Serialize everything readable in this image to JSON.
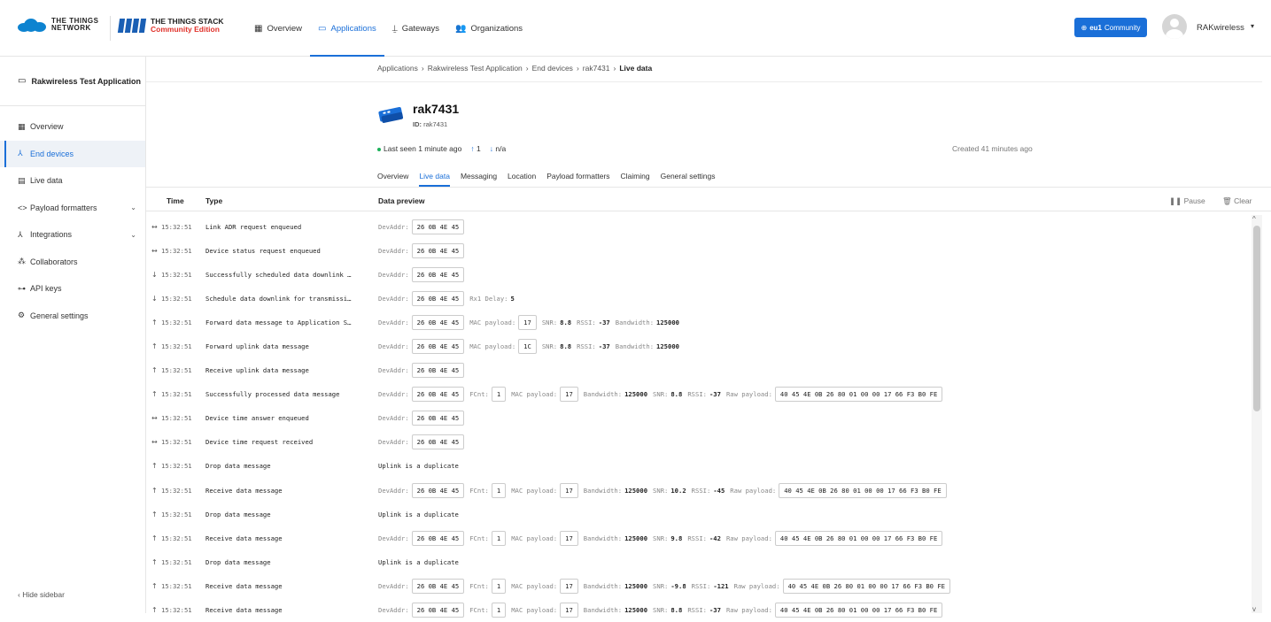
{
  "header": {
    "ttn_logo_line1": "THE THINGS",
    "ttn_logo_line2": "NETWORK",
    "stack_logo_line1": "THE THINGS STACK",
    "stack_logo_line2": "Community Edition",
    "nav": [
      {
        "label": "Overview",
        "icon": "grid-icon"
      },
      {
        "label": "Applications",
        "icon": "window-icon"
      },
      {
        "label": "Gateways",
        "icon": "gateway-icon"
      },
      {
        "label": "Organizations",
        "icon": "people-icon"
      }
    ],
    "region_bold": "eu1",
    "region_text": "Community",
    "user_name": "RAKwireless",
    "accent": "#1a6fd8"
  },
  "sidebar": {
    "app_name": "Rakwireless Test Application",
    "items": [
      {
        "label": "Overview",
        "icon": "grid-icon"
      },
      {
        "label": "End devices",
        "icon": "devices-icon"
      },
      {
        "label": "Live data",
        "icon": "live-data-icon"
      },
      {
        "label": "Payload formatters",
        "icon": "code-icon"
      },
      {
        "label": "Integrations",
        "icon": "integrations-icon"
      },
      {
        "label": "Collaborators",
        "icon": "people-icon"
      },
      {
        "label": "API keys",
        "icon": "key-icon"
      },
      {
        "label": "General settings",
        "icon": "gear-icon"
      }
    ],
    "hide_label": "Hide sidebar"
  },
  "breadcrumb": [
    "Applications",
    "Rakwireless Test Application",
    "End devices",
    "rak7431",
    "Live data"
  ],
  "device": {
    "name": "rak7431",
    "id_label": "ID:",
    "id": "rak7431",
    "last_seen": "Last seen 1 minute ago",
    "uplink": "1",
    "downlink": "n/a",
    "created": "Created 41 minutes ago"
  },
  "tabs": [
    "Overview",
    "Live data",
    "Messaging",
    "Location",
    "Payload formatters",
    "Claiming",
    "General settings"
  ],
  "table": {
    "headers": {
      "time": "Time",
      "type": "Type",
      "preview": "Data preview"
    },
    "pause_label": "Pause",
    "clear_label": "Clear",
    "rows": [
      {
        "dir": "↔",
        "time": "15:32:51",
        "type": "Link ADR request enqueued",
        "preview": [
          {
            "l": "DevAddr:",
            "b": "26 0B 4E 45"
          }
        ]
      },
      {
        "dir": "↔",
        "time": "15:32:51",
        "type": "Device status request enqueued",
        "preview": [
          {
            "l": "DevAddr:",
            "b": "26 0B 4E 45"
          }
        ]
      },
      {
        "dir": "↓",
        "time": "15:32:51",
        "type": "Successfully scheduled data downlink …",
        "preview": [
          {
            "l": "DevAddr:",
            "b": "26 0B 4E 45"
          }
        ]
      },
      {
        "dir": "↓",
        "time": "15:32:51",
        "type": "Schedule data downlink for transmissi…",
        "preview": [
          {
            "l": "DevAddr:",
            "b": "26 0B 4E 45"
          },
          {
            "l": "Rx1 Delay:",
            "v": "5"
          }
        ]
      },
      {
        "dir": "↑",
        "time": "15:32:51",
        "type": "Forward data message to Application S…",
        "preview": [
          {
            "l": "DevAddr:",
            "b": "26 0B 4E 45"
          },
          {
            "l": "MAC payload:",
            "b": "17"
          },
          {
            "l": "SNR:",
            "v": "8.8"
          },
          {
            "l": "RSSI:",
            "v": "-37"
          },
          {
            "l": "Bandwidth:",
            "v": "125000"
          }
        ]
      },
      {
        "dir": "↑",
        "time": "15:32:51",
        "type": "Forward uplink data message",
        "preview": [
          {
            "l": "DevAddr:",
            "b": "26 0B 4E 45"
          },
          {
            "l": "MAC payload:",
            "b": "1C"
          },
          {
            "l": "SNR:",
            "v": "8.8"
          },
          {
            "l": "RSSI:",
            "v": "-37"
          },
          {
            "l": "Bandwidth:",
            "v": "125000"
          }
        ]
      },
      {
        "dir": "↑",
        "time": "15:32:51",
        "type": "Receive uplink data message",
        "preview": [
          {
            "l": "DevAddr:",
            "b": "26 0B 4E 45"
          }
        ]
      },
      {
        "dir": "↑",
        "time": "15:32:51",
        "type": "Successfully processed data message",
        "preview": [
          {
            "l": "DevAddr:",
            "b": "26 0B 4E 45"
          },
          {
            "l": "FCnt:",
            "b": "1"
          },
          {
            "l": "MAC payload:",
            "b": "17"
          },
          {
            "l": "Bandwidth:",
            "v": "125000"
          },
          {
            "l": "SNR:",
            "v": "8.8"
          },
          {
            "l": "RSSI:",
            "v": "-37"
          },
          {
            "l": "Raw payload:",
            "b": "40 45 4E 0B 26 80 01 00 00 17 66 F3 B0 FE"
          }
        ]
      },
      {
        "dir": "↔",
        "time": "15:32:51",
        "type": "Device time answer enqueued",
        "preview": [
          {
            "l": "DevAddr:",
            "b": "26 0B 4E 45"
          }
        ]
      },
      {
        "dir": "↔",
        "time": "15:32:51",
        "type": "Device time request received",
        "preview": [
          {
            "l": "DevAddr:",
            "b": "26 0B 4E 45"
          }
        ]
      },
      {
        "dir": "↑",
        "time": "15:32:51",
        "type": "Drop data message",
        "preview": [
          {
            "t": "Uplink is a duplicate"
          }
        ]
      },
      {
        "dir": "↑",
        "time": "15:32:51",
        "type": "Receive data message",
        "preview": [
          {
            "l": "DevAddr:",
            "b": "26 0B 4E 45"
          },
          {
            "l": "FCnt:",
            "b": "1"
          },
          {
            "l": "MAC payload:",
            "b": "17"
          },
          {
            "l": "Bandwidth:",
            "v": "125000"
          },
          {
            "l": "SNR:",
            "v": "10.2"
          },
          {
            "l": "RSSI:",
            "v": "-45"
          },
          {
            "l": "Raw payload:",
            "b": "40 45 4E 0B 26 80 01 00 00 17 66 F3 B0 FE"
          }
        ]
      },
      {
        "dir": "↑",
        "time": "15:32:51",
        "type": "Drop data message",
        "preview": [
          {
            "t": "Uplink is a duplicate"
          }
        ]
      },
      {
        "dir": "↑",
        "time": "15:32:51",
        "type": "Receive data message",
        "preview": [
          {
            "l": "DevAddr:",
            "b": "26 0B 4E 45"
          },
          {
            "l": "FCnt:",
            "b": "1"
          },
          {
            "l": "MAC payload:",
            "b": "17"
          },
          {
            "l": "Bandwidth:",
            "v": "125000"
          },
          {
            "l": "SNR:",
            "v": "9.8"
          },
          {
            "l": "RSSI:",
            "v": "-42"
          },
          {
            "l": "Raw payload:",
            "b": "40 45 4E 0B 26 80 01 00 00 17 66 F3 B0 FE"
          }
        ]
      },
      {
        "dir": "↑",
        "time": "15:32:51",
        "type": "Drop data message",
        "preview": [
          {
            "t": "Uplink is a duplicate"
          }
        ]
      },
      {
        "dir": "↑",
        "time": "15:32:51",
        "type": "Receive data message",
        "preview": [
          {
            "l": "DevAddr:",
            "b": "26 0B 4E 45"
          },
          {
            "l": "FCnt:",
            "b": "1"
          },
          {
            "l": "MAC payload:",
            "b": "17"
          },
          {
            "l": "Bandwidth:",
            "v": "125000"
          },
          {
            "l": "SNR:",
            "v": "-9.8"
          },
          {
            "l": "RSSI:",
            "v": "-121"
          },
          {
            "l": "Raw payload:",
            "b": "40 45 4E 0B 26 80 01 00 00 17 66 F3 B0 FE"
          }
        ]
      },
      {
        "dir": "↑",
        "time": "15:32:51",
        "type": "Receive data message",
        "preview": [
          {
            "l": "DevAddr:",
            "b": "26 0B 4E 45"
          },
          {
            "l": "FCnt:",
            "b": "1"
          },
          {
            "l": "MAC payload:",
            "b": "17"
          },
          {
            "l": "Bandwidth:",
            "v": "125000"
          },
          {
            "l": "SNR:",
            "v": "8.8"
          },
          {
            "l": "RSSI:",
            "v": "-37"
          },
          {
            "l": "Raw payload:",
            "b": "40 45 4E 0B 26 80 01 00 00 17 66 F3 B0 FE"
          }
        ]
      }
    ]
  }
}
